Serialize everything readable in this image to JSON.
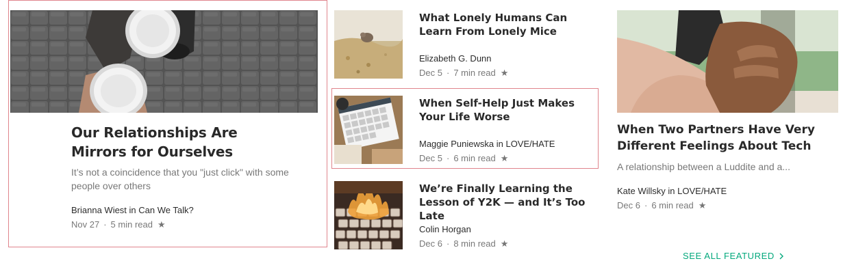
{
  "featured": {
    "title": "Our Relationships Are Mirrors for Ourselves",
    "subtitle": "It’s not a coincidence that you \"just click\" with some people over others",
    "author": "Brianna Wiest in Can We Talk?",
    "date": "Nov 27",
    "read_time": "5 min read",
    "image_icon": "coffee-cups-photo"
  },
  "middle_list": [
    {
      "title": "What Lonely Humans Can Learn From Lonely Mice",
      "author": "Elizabeth G. Dunn",
      "date": "Dec 5",
      "read_time": "7 min read",
      "image_icon": "mouse-photo"
    },
    {
      "title": "When Self-Help Just Makes Your Life Worse",
      "author": "Maggie Puniewska in LOVE/HATE",
      "date": "Dec 5",
      "read_time": "6 min read",
      "image_icon": "calendar-photo"
    },
    {
      "title": "We’re Finally Learning the Lesson of Y2K — and It’s Too Late",
      "author": "Colin Horgan",
      "date": "Dec 6",
      "read_time": "8 min read",
      "image_icon": "burning-keyboard-photo"
    }
  ],
  "right_card": {
    "title": "When Two Partners Have Very Different Feelings About Tech",
    "subtitle": "A relationship between a Luddite and a...",
    "author": "Kate Willsky in LOVE/HATE",
    "date": "Dec 6",
    "read_time": "6 min read",
    "image_icon": "holding-hands-photo"
  },
  "see_all": {
    "label": "SEE ALL FEATURED"
  },
  "colors": {
    "accent": "#03a87c",
    "highlight_border": "#e0848c"
  }
}
